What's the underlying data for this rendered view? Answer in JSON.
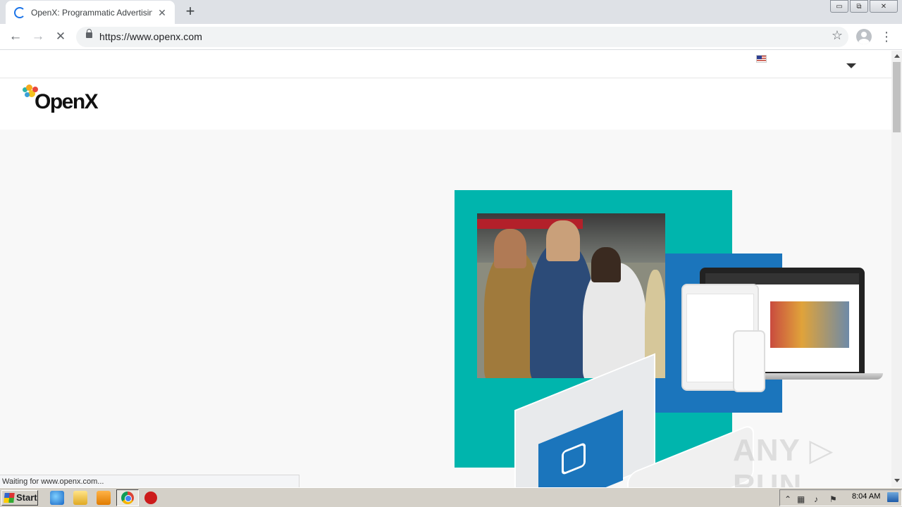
{
  "browser": {
    "tab_title": "OpenX: Programmatic Advertising | A",
    "tab_close": "✕",
    "new_tab": "+",
    "url": "https://www.openx.com",
    "back": "←",
    "forward": "→",
    "stop": "✕",
    "bookmark": "☆",
    "menu": "⋮",
    "status_text": "Waiting for www.openx.com..."
  },
  "window_controls": {
    "minimize": "▭",
    "restore": "⧉",
    "close": "✕"
  },
  "page": {
    "logo_text": "OpenX",
    "language_flag": "us-flag-icon",
    "watermark": "ANY ▷ RUN"
  },
  "taskbar": {
    "start_label": "Start",
    "clock": "8:04 AM"
  },
  "colors": {
    "teal": "#00b5ad",
    "blue": "#1b75bc",
    "page_bg": "#f8f8f8"
  }
}
